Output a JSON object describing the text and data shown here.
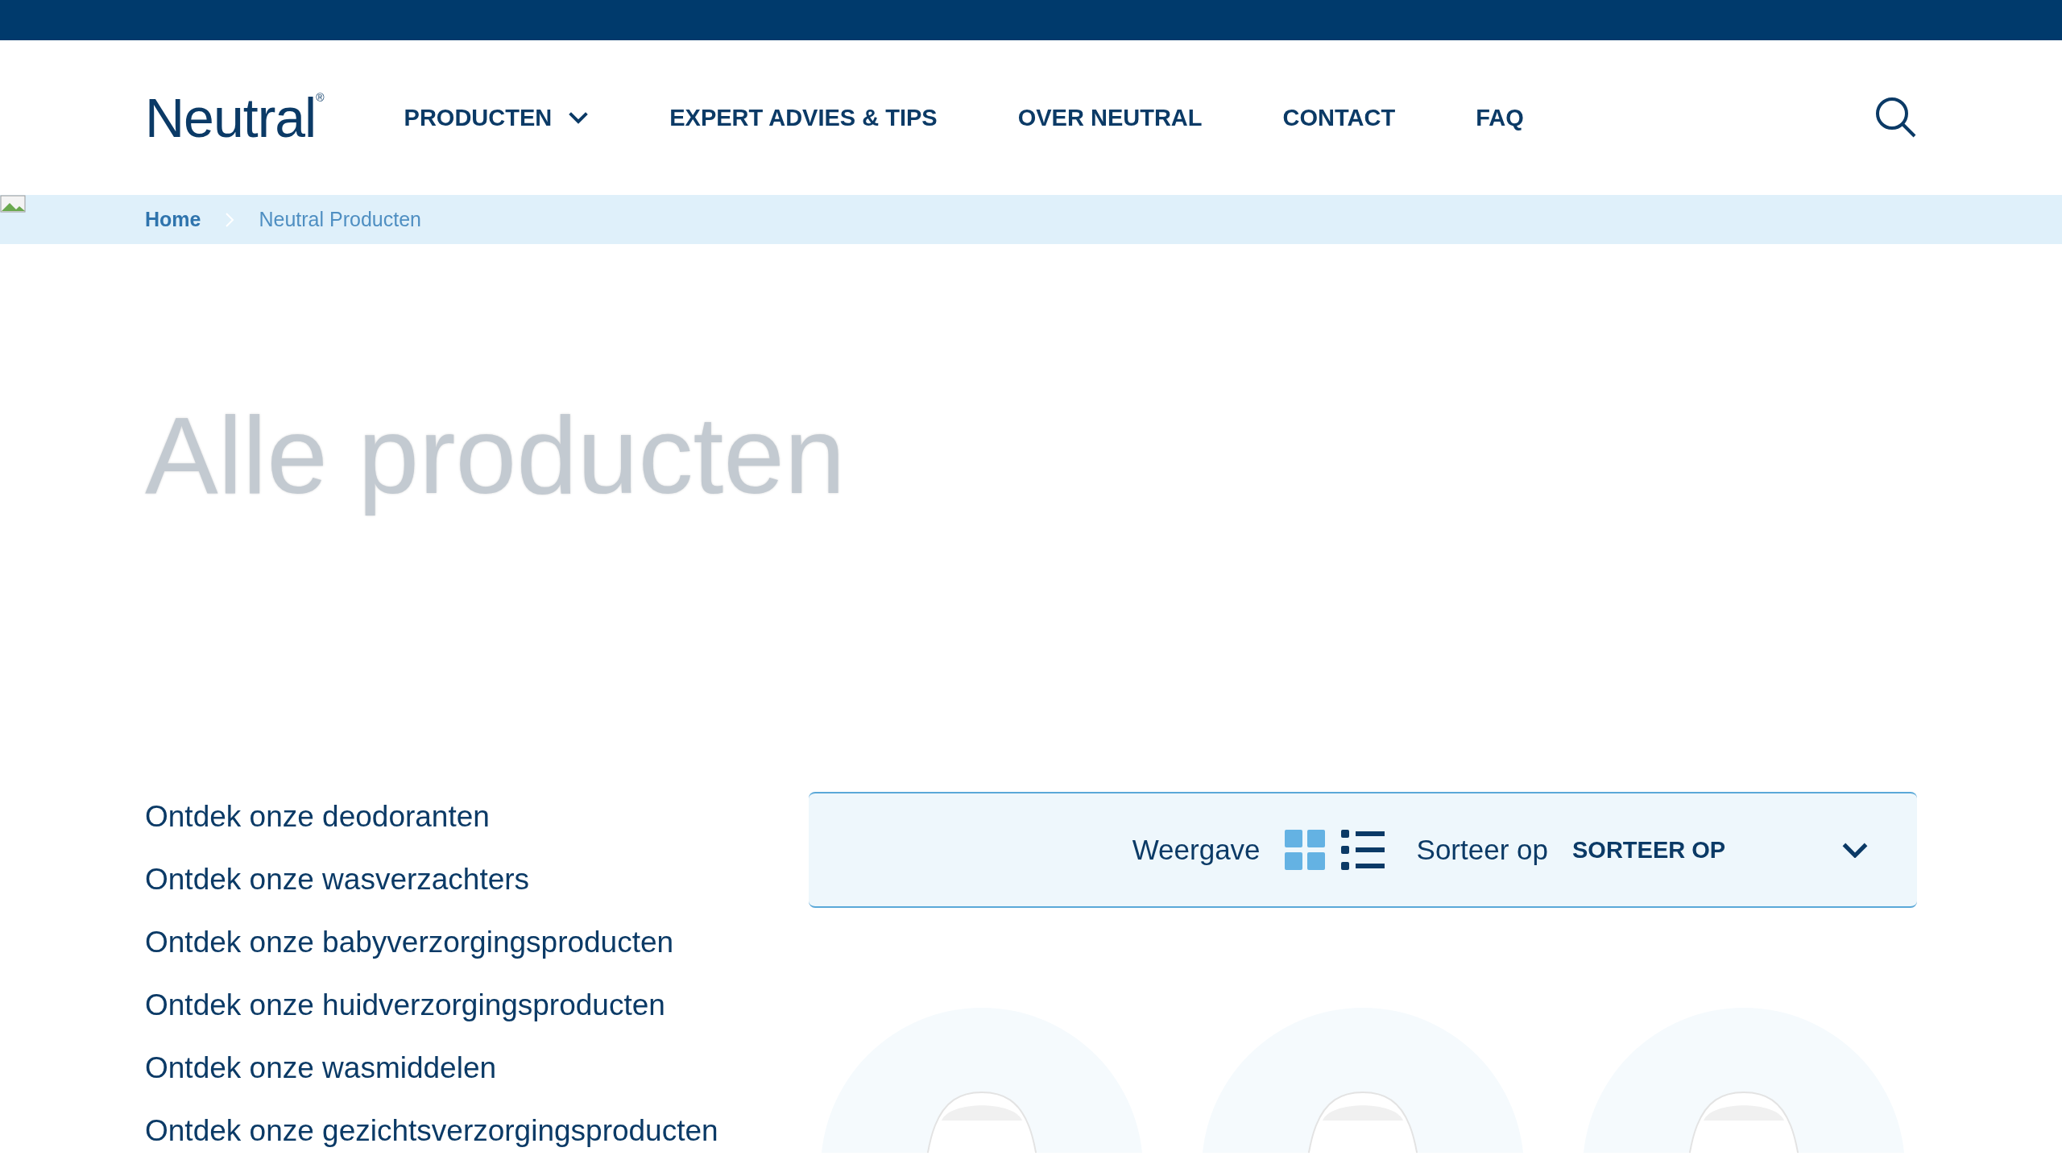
{
  "logo": {
    "name": "Neutral",
    "mark": "®"
  },
  "nav": [
    {
      "label": "PRODUCTEN",
      "dropdown": true
    },
    {
      "label": "EXPERT ADVIES & TIPS",
      "dropdown": false
    },
    {
      "label": "OVER NEUTRAL",
      "dropdown": false
    },
    {
      "label": "CONTACT",
      "dropdown": false
    },
    {
      "label": "FAQ",
      "dropdown": false
    }
  ],
  "breadcrumb": [
    {
      "label": "Home",
      "current": false
    },
    {
      "label": "Neutral Producten",
      "current": true
    }
  ],
  "title": "Alle producten",
  "categories": [
    "Ontdek onze deodoranten",
    "Ontdek onze wasverzachters",
    "Ontdek onze babyverzorgingsproducten",
    "Ontdek onze huidverzorgingsproducten",
    "Ontdek onze wasmiddelen",
    "Ontdek onze gezichtsverzorgingsproducten"
  ],
  "toolbar": {
    "view_label": "Weergave",
    "views": [
      {
        "kind": "grid",
        "selected": true
      },
      {
        "kind": "list",
        "selected": false
      }
    ],
    "sort_label": "Sorteer op",
    "sort_value": "SORTEER OP"
  }
}
